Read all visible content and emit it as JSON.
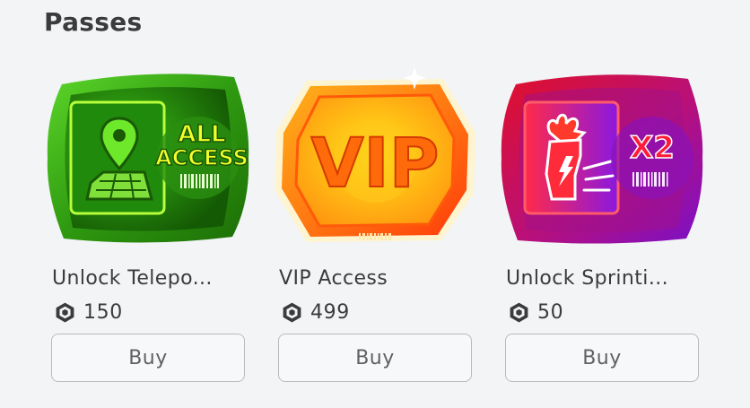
{
  "section": {
    "title": "Passes"
  },
  "colors": {
    "background": "#f2f4f5",
    "text": "#393b3d",
    "button_border": "#b8babd"
  },
  "passes": [
    {
      "name": "Unlock Telepo...",
      "price": "150",
      "currency_icon": "robux-icon",
      "buy_label": "Buy",
      "art": {
        "badge_text_1": "ALL",
        "badge_text_2": "ACCESS",
        "icon": "map-pin-icon"
      }
    },
    {
      "name": "VIP Access",
      "price": "499",
      "currency_icon": "robux-icon",
      "buy_label": "Buy",
      "art": {
        "badge_text": "VIP"
      }
    },
    {
      "name": "Unlock Sprinti...",
      "price": "50",
      "currency_icon": "robux-icon",
      "buy_label": "Buy",
      "art": {
        "badge_text": "X2",
        "icon": "flaming-shoe-icon"
      }
    }
  ]
}
